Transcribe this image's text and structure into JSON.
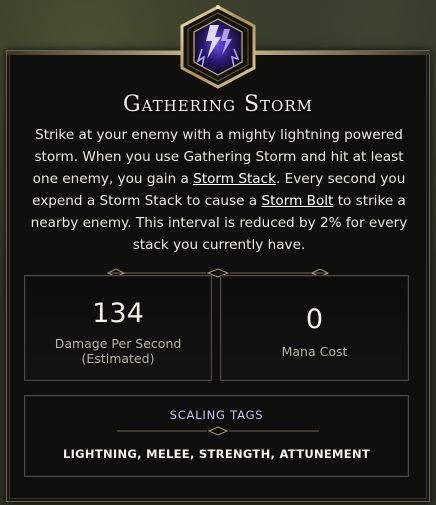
{
  "ability": {
    "icon": "lightning-fist-icon",
    "name": "Gathering Storm",
    "description": {
      "p1": "Strike at your enemy with a mighty lightning powered storm. When you use Gathering Storm and hit at least one enemy, you gain a ",
      "link1": "Storm Stack",
      "p2": ". Every second you expend a Storm Stack to cause a ",
      "link2": "Storm Bolt",
      "p3": " to strike a nearby enemy. This interval is reduced by 2% for every stack you currently have."
    }
  },
  "stats": {
    "damage": {
      "value": "134",
      "label_line1": "Damage Per Second",
      "label_line2": "(Estimated)"
    },
    "mana": {
      "value": "0",
      "label": "Mana Cost"
    }
  },
  "scaling": {
    "title": "SCALING TAGS",
    "tags": "LIGHTNING, MELEE, STRENGTH, ATTUNEMENT"
  },
  "colors": {
    "accent_gold": "#c8b78a",
    "tag_title": "#c9c4f0",
    "icon_purple": "#7a5cf0"
  }
}
